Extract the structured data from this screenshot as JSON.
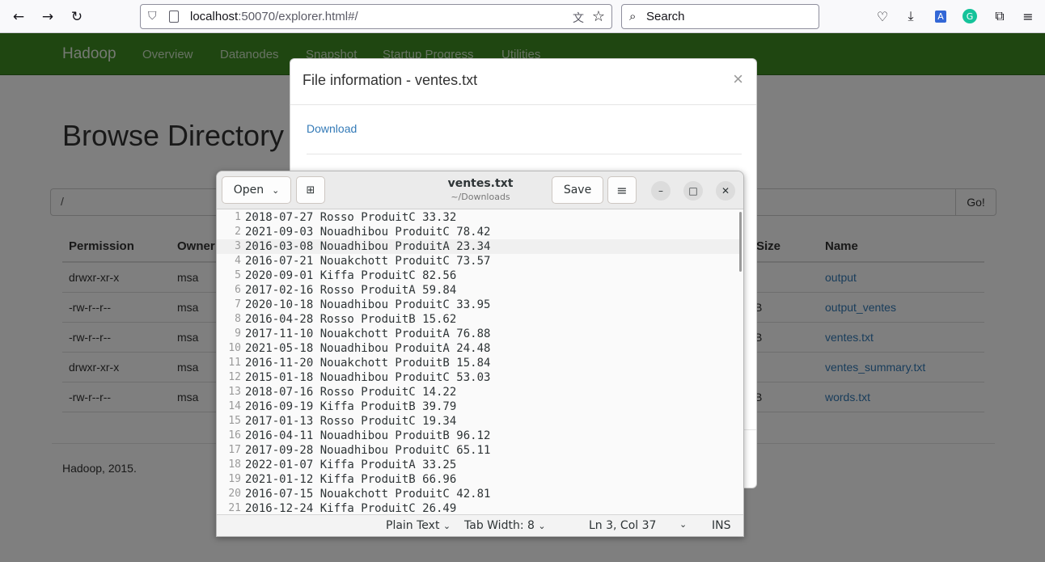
{
  "browser": {
    "url_host": "localhost",
    "url_rest": ":50070/explorer.html#/",
    "search_placeholder": "Search"
  },
  "hadoop": {
    "brand": "Hadoop",
    "nav": [
      "Overview",
      "Datanodes",
      "Snapshot",
      "Startup Progress",
      "Utilities"
    ],
    "page_title": "Browse Directory",
    "path_value": "/",
    "go_label": "Go!",
    "columns": {
      "permission": "Permission",
      "owner": "Owner",
      "block_size": "Block Size",
      "name": "Name"
    },
    "rows": [
      {
        "permission": "drwxr-xr-x",
        "owner": "msa",
        "size_frag": "",
        "name": "output"
      },
      {
        "permission": "-rw-r--r--",
        "owner": "msa",
        "size_frag": "B",
        "name": "output_ventes"
      },
      {
        "permission": "-rw-r--r--",
        "owner": "msa",
        "size_frag": "B",
        "name": "ventes.txt"
      },
      {
        "permission": "drwxr-xr-x",
        "owner": "msa",
        "size_frag": "",
        "name": "ventes_summary.txt"
      },
      {
        "permission": "-rw-r--r--",
        "owner": "msa",
        "size_frag": "B",
        "name": "words.txt"
      }
    ],
    "footer": "Hadoop, 2015."
  },
  "modal": {
    "title": "File information - ventes.txt",
    "close": "×",
    "download": "Download"
  },
  "gedit": {
    "open_label": "Open",
    "save_label": "Save",
    "title": "ventes.txt",
    "subtitle": "~/Downloads",
    "current_line": 3,
    "lines": [
      "2018-07-27 Rosso ProduitC 33.32",
      "2021-09-03 Nouadhibou ProduitC 78.42",
      "2016-03-08 Nouadhibou ProduitA 23.34",
      "2016-07-21 Nouakchott ProduitC 73.57",
      "2020-09-01 Kiffa ProduitC 82.56",
      "2017-02-16 Rosso ProduitA 59.84",
      "2020-10-18 Nouadhibou ProduitC 33.95",
      "2016-04-28 Rosso ProduitB 15.62",
      "2017-11-10 Nouakchott ProduitA 76.88",
      "2021-05-18 Nouadhibou ProduitA 24.48",
      "2016-11-20 Nouakchott ProduitB 15.84",
      "2015-01-18 Nouadhibou ProduitC 53.03",
      "2018-07-16 Rosso ProduitC 14.22",
      "2016-09-19 Kiffa ProduitB 39.79",
      "2017-01-13 Rosso ProduitC 19.34",
      "2016-04-11 Nouadhibou ProduitB 96.12",
      "2017-09-28 Nouadhibou ProduitC 65.11",
      "2022-01-07 Kiffa ProduitA 33.25",
      "2021-01-12 Kiffa ProduitB 66.96",
      "2016-07-15 Nouakchott ProduitC 42.81",
      "2016-12-24 Kiffa ProduitC 26.49"
    ],
    "status": {
      "language": "Plain Text",
      "tab_width": "Tab Width: 8",
      "position": "Ln 3, Col 37",
      "mode": "INS"
    }
  }
}
